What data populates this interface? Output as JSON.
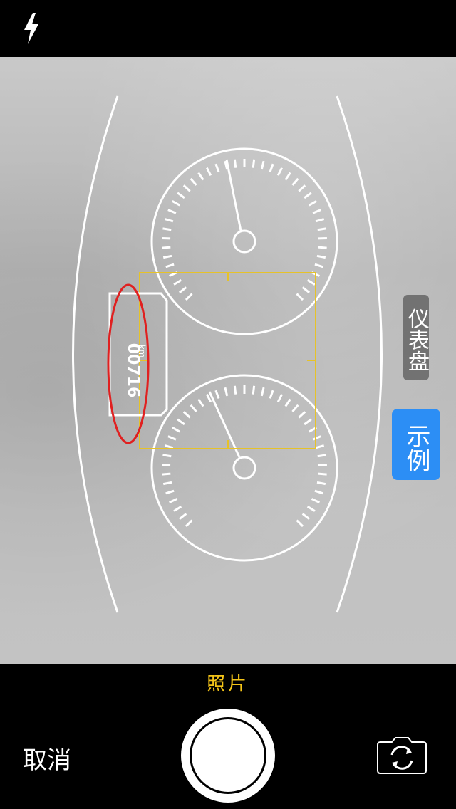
{
  "camera": {
    "mode_label": "照片",
    "cancel_label": "取消",
    "side_labels": {
      "dashboard": "仪表盘",
      "example": "示例"
    },
    "odometer": {
      "value": "00716",
      "unit": "km"
    }
  },
  "icons": {
    "flash": "flash-icon",
    "switch_camera": "camera-switch-icon"
  },
  "colors": {
    "mode_label": "#f5c518",
    "example_badge": "#2c8ef5",
    "guide_frame": "#e6c229",
    "highlight_ellipse": "#e02020"
  }
}
